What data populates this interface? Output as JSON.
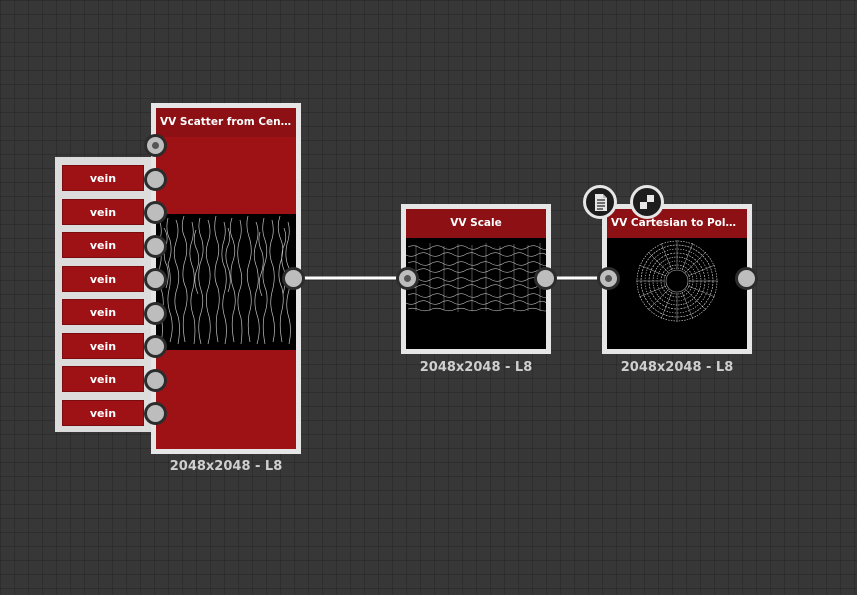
{
  "nodes": {
    "scatter": {
      "title": "VV Scatter from Center ...",
      "resolution": "2048x2048 - L8",
      "inputs": [
        "vein",
        "vein",
        "vein",
        "vein",
        "vein",
        "vein",
        "vein",
        "vein"
      ]
    },
    "scale": {
      "title": "VV Scale",
      "resolution": "2048x2048 - L8"
    },
    "polar": {
      "title": "VV Cartesian to Polar Gr...",
      "resolution": "2048x2048 - L8"
    }
  },
  "icons": {
    "document": "document-icon",
    "checker": "checkerboard-icon"
  },
  "colors": {
    "background": "#373737",
    "node_red": "#9e1216",
    "node_header": "#8c1014",
    "wire": "#ffffff",
    "label": "#cfcfcf"
  }
}
